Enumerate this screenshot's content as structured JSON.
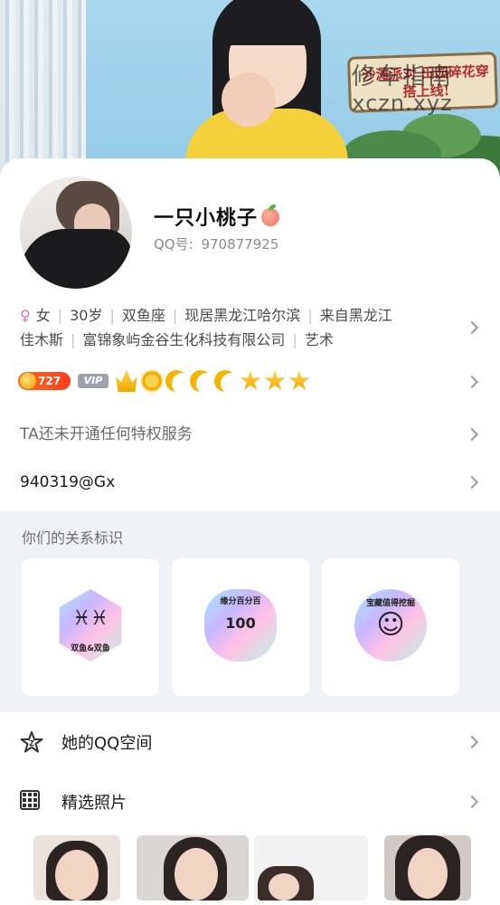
{
  "banner": {
    "sign_text": "沙滩派对 田园碎花穿搭上线!",
    "watermark_line1": "修车指南",
    "watermark_line2": "xczn.xyz"
  },
  "profile": {
    "nickname": "一只小桃子",
    "qq_label": "QQ号:",
    "qq_number": "970877925",
    "info": {
      "gender_symbol": "♀",
      "gender": "女",
      "age": "30岁",
      "zodiac": "双鱼座",
      "residence": "现居黑龙江哈尔滨",
      "hometown": "来自黑龙江",
      "hometown_city": "佳木斯",
      "company": "富锦象屿金谷生化科技有限公司",
      "occupation": "艺术"
    },
    "level": "727",
    "vip_label": "VIP",
    "level_icons": [
      "crown-icon",
      "sun-icon",
      "moon-icon",
      "moon-icon",
      "moon-icon",
      "star-icon",
      "star-icon",
      "star-icon"
    ],
    "privilege_text": "TA还未开通任何特权服务",
    "signature": "940319@Gx"
  },
  "relation": {
    "title": "你们的关系标识",
    "cards": [
      {
        "label": "双鱼&双鱼",
        "glyph": "♓♓"
      },
      {
        "label": "缘分百分百",
        "glyph": "100"
      },
      {
        "label": "宝藏值得挖掘",
        "glyph": "☺"
      }
    ]
  },
  "list": {
    "qzone_label": "她的QQ空间",
    "photos_label": "精选照片"
  },
  "colors": {
    "accent_female": "#f06aa6",
    "level_badge": "#ff4a1f",
    "vip_badge": "#9ea3ab",
    "icon_gold": "#f5b400"
  }
}
